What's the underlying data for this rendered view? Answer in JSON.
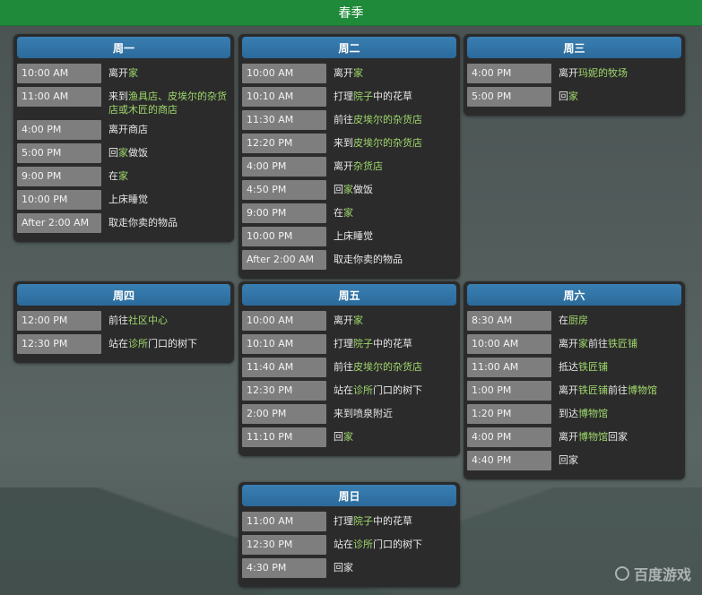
{
  "title": "春季",
  "watermark": "百度游戏",
  "days": [
    {
      "name": "周一",
      "rows": [
        {
          "time": "10:00 AM",
          "parts": [
            [
              "离开",
              0
            ],
            [
              "家",
              1
            ]
          ]
        },
        {
          "time": "11:00 AM",
          "parts": [
            [
              "来到",
              0
            ],
            [
              "渔具店、皮埃尔的杂货店或木匠的商店",
              1
            ]
          ]
        },
        {
          "time": "4:00 PM",
          "parts": [
            [
              "离开商店",
              0
            ]
          ]
        },
        {
          "time": "5:00 PM",
          "parts": [
            [
              "回",
              0
            ],
            [
              "家",
              1
            ],
            [
              "做饭",
              0
            ]
          ]
        },
        {
          "time": "9:00 PM",
          "parts": [
            [
              "在",
              0
            ],
            [
              "家",
              1
            ]
          ]
        },
        {
          "time": "10:00 PM",
          "parts": [
            [
              "上床睡觉",
              0
            ]
          ]
        },
        {
          "time": "After 2:00 AM",
          "parts": [
            [
              "取走你卖的物品",
              0
            ]
          ]
        }
      ]
    },
    {
      "name": "周二",
      "rows": [
        {
          "time": "10:00 AM",
          "parts": [
            [
              "离开",
              0
            ],
            [
              "家",
              1
            ]
          ]
        },
        {
          "time": "10:10 AM",
          "parts": [
            [
              "打理",
              0
            ],
            [
              "院子",
              1
            ],
            [
              "中的花草",
              0
            ]
          ]
        },
        {
          "time": "11:30 AM",
          "parts": [
            [
              "前往",
              0
            ],
            [
              "皮埃尔的杂货店",
              1
            ]
          ]
        },
        {
          "time": "12:20 PM",
          "parts": [
            [
              "来到",
              0
            ],
            [
              "皮埃尔的杂货店",
              1
            ]
          ]
        },
        {
          "time": "4:00 PM",
          "parts": [
            [
              "离开",
              0
            ],
            [
              "杂货店",
              1
            ]
          ]
        },
        {
          "time": "4:50 PM",
          "parts": [
            [
              "回",
              0
            ],
            [
              "家",
              1
            ],
            [
              "做饭",
              0
            ]
          ]
        },
        {
          "time": "9:00 PM",
          "parts": [
            [
              "在",
              0
            ],
            [
              "家",
              1
            ]
          ]
        },
        {
          "time": "10:00 PM",
          "parts": [
            [
              "上床睡觉",
              0
            ]
          ]
        },
        {
          "time": "After 2:00 AM",
          "parts": [
            [
              "取走你卖的物品",
              0
            ]
          ]
        }
      ]
    },
    {
      "name": "周三",
      "rows": [
        {
          "time": "4:00 PM",
          "parts": [
            [
              "离开",
              0
            ],
            [
              "玛妮的牧场",
              1
            ]
          ]
        },
        {
          "time": "5:00 PM",
          "parts": [
            [
              "回",
              0
            ],
            [
              "家",
              1
            ]
          ]
        }
      ]
    },
    {
      "name": "周四",
      "rows": [
        {
          "time": "12:00 PM",
          "parts": [
            [
              "前往",
              0
            ],
            [
              "社区中心",
              1
            ]
          ]
        },
        {
          "time": "12:30 PM",
          "parts": [
            [
              "站在",
              0
            ],
            [
              "诊所",
              1
            ],
            [
              "门口的树下",
              0
            ]
          ]
        }
      ]
    },
    {
      "name": "周五",
      "rows": [
        {
          "time": "10:00 AM",
          "parts": [
            [
              "离开",
              0
            ],
            [
              "家",
              1
            ]
          ]
        },
        {
          "time": "10:10 AM",
          "parts": [
            [
              "打理",
              0
            ],
            [
              "院子",
              1
            ],
            [
              "中的花草",
              0
            ]
          ]
        },
        {
          "time": "11:40 AM",
          "parts": [
            [
              "前往",
              0
            ],
            [
              "皮埃尔的杂货店",
              1
            ]
          ]
        },
        {
          "time": "12:30 PM",
          "parts": [
            [
              "站在",
              0
            ],
            [
              "诊所",
              1
            ],
            [
              "门口的树下",
              0
            ]
          ]
        },
        {
          "time": "2:00 PM",
          "parts": [
            [
              "来到喷泉附近",
              0
            ]
          ]
        },
        {
          "time": "11:10 PM",
          "parts": [
            [
              "回",
              0
            ],
            [
              "家",
              1
            ]
          ]
        }
      ]
    },
    {
      "name": "周六",
      "rows": [
        {
          "time": "8:30 AM",
          "parts": [
            [
              "在",
              0
            ],
            [
              "厨房",
              1
            ]
          ]
        },
        {
          "time": "10:00 AM",
          "parts": [
            [
              "离开",
              0
            ],
            [
              "家",
              1
            ],
            [
              "前往",
              0
            ],
            [
              "铁匠铺",
              1
            ]
          ]
        },
        {
          "time": "11:00 AM",
          "parts": [
            [
              "抵达",
              0
            ],
            [
              "铁匠铺",
              1
            ]
          ]
        },
        {
          "time": "1:00 PM",
          "parts": [
            [
              "离开",
              0
            ],
            [
              "铁匠铺",
              1
            ],
            [
              "前往",
              0
            ],
            [
              "博物馆",
              1
            ]
          ]
        },
        {
          "time": "1:20 PM",
          "parts": [
            [
              "到达",
              0
            ],
            [
              "博物馆",
              1
            ]
          ]
        },
        {
          "time": "4:00 PM",
          "parts": [
            [
              "离开",
              0
            ],
            [
              "博物馆",
              1
            ],
            [
              "回家",
              0
            ]
          ]
        },
        {
          "time": "4:40 PM",
          "parts": [
            [
              "回家",
              0
            ]
          ]
        }
      ]
    },
    {
      "name": "周日",
      "rows": [
        {
          "time": "11:00 AM",
          "parts": [
            [
              "打理",
              0
            ],
            [
              "院子",
              1
            ],
            [
              "中的花草",
              0
            ]
          ]
        },
        {
          "time": "12:30 PM",
          "parts": [
            [
              "站在",
              0
            ],
            [
              "诊所",
              1
            ],
            [
              "门口的树下",
              0
            ]
          ]
        },
        {
          "time": "4:30 PM",
          "parts": [
            [
              "回家",
              0
            ]
          ]
        }
      ]
    }
  ]
}
